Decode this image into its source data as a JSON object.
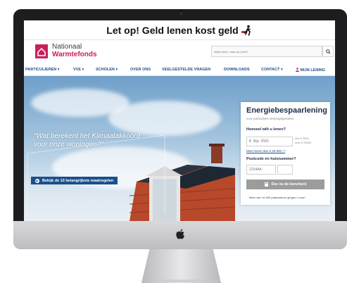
{
  "warning": {
    "text": "Let op! Geld lenen kost geld"
  },
  "logo": {
    "line1": "Nationaal",
    "line2_bold": "Warmte",
    "line2_rest": "fonds"
  },
  "search": {
    "placeholder": "Waar bent u naar op zoek?"
  },
  "nav": {
    "items": [
      {
        "label": "PARTICULIEREN ▾"
      },
      {
        "label": "VVE ▾"
      },
      {
        "label": "SCHOLEN ▾"
      },
      {
        "label": "OVER ONS"
      },
      {
        "label": "VEELGESTELDE VRAGEN"
      },
      {
        "label": "DOWNLOADS"
      },
      {
        "label": "CONTACT ▾"
      }
    ],
    "user_label": "MIJN LENING"
  },
  "hero": {
    "quote": "\"Wat berekent het Klimaatakkoord voor onze woningen?\"",
    "cta_label": "Bekijk de 10 belangrijkste maatregelen"
  },
  "form": {
    "title": "Energiebespaarlening",
    "subtitle": "voor particuliere woningeigenaren",
    "amount_label": "Hoeveel wilt u lenen?",
    "amount_placeholder": "Bijv. 2500",
    "currency": "€",
    "min_text": "min € 2500",
    "max_text": "max € 25000",
    "more_link": "Meer lenen dan € 25.000,-?",
    "postcode_label": "Postcode en huisnummer?",
    "postcode_placeholder": "1234AA",
    "house_placeholder": "",
    "submit_label": "Doe nu de leencheck",
    "footer_text": "Meer dan 10.000 particulieren gingen u voor!"
  },
  "colors": {
    "brand": "#c8205e",
    "nav": "#1c4f8c",
    "button_disabled": "#9c9c9c"
  }
}
